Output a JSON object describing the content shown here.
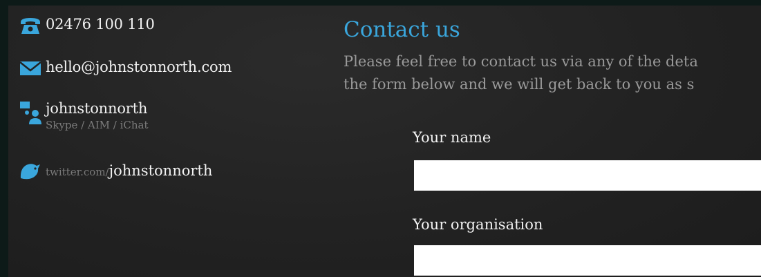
{
  "contact": {
    "phone": "02476 100 110",
    "email": "hello@johnstonnorth.com",
    "chat_handle": "johnstonnorth",
    "chat_services": "Skype / AIM / iChat",
    "twitter_prefix": "twitter.com/",
    "twitter_handle": "johnstonnorth"
  },
  "main": {
    "heading": "Contact us",
    "intro_line1": "Please feel free to contact us via any of the deta",
    "intro_line2": "the form below and we will get back to you as s"
  },
  "form": {
    "name_label": "Your name",
    "name_value": "",
    "organisation_label": "Your organisation",
    "organisation_value": ""
  },
  "colors": {
    "accent": "#3aa6dc",
    "background": "#222222",
    "text": "#f2f2f2",
    "muted": "#9a9a9a"
  },
  "icons": {
    "phone": "phone-icon",
    "email": "envelope-icon",
    "chat": "chat-people-icon",
    "twitter": "twitter-bird-icon"
  }
}
